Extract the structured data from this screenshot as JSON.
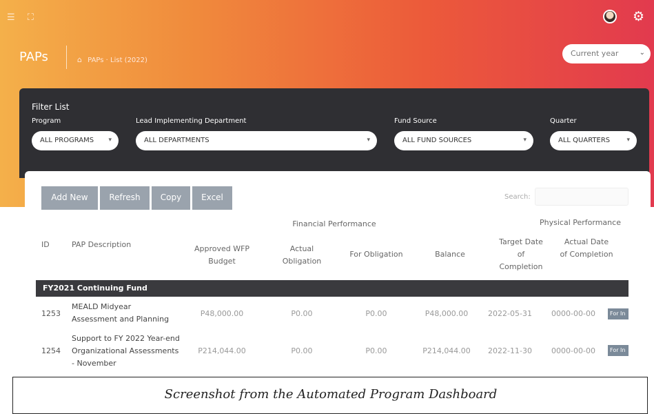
{
  "header": {
    "title": "PAPs",
    "breadcrumb": "PAPs · List (2022)",
    "year_select": "Current year"
  },
  "filter": {
    "title": "Filter List",
    "program": {
      "label": "Program",
      "value": "ALL PROGRAMS"
    },
    "department": {
      "label": "Lead Implementing Department",
      "value": "ALL DEPARTMENTS"
    },
    "fund_source": {
      "label": "Fund Source",
      "value": "ALL FUND SOURCES"
    },
    "quarter": {
      "label": "Quarter",
      "value": "ALL QUARTERS"
    }
  },
  "toolbar": {
    "add_new": "Add New",
    "refresh": "Refresh",
    "copy": "Copy",
    "excel": "Excel",
    "search_label": "Search:"
  },
  "table": {
    "group_financial": "Financial Performance",
    "group_physical": "Physical Performance",
    "col_id": "ID",
    "col_desc": "PAP Description",
    "col_budget": "Approved WFP Budget",
    "col_actual": "Actual Obligation",
    "col_for_obligation": "For Obligation",
    "col_balance": "Balance",
    "col_target": "Target Date of Completion",
    "col_actual_date": "Actual Date of Completion",
    "group_row": "FY2021 Continuing Fund",
    "rows": [
      {
        "id": "1253",
        "desc": "MEALD Midyear Assessment and Planning",
        "budget": "P48,000.00",
        "actual": "P0.00",
        "for_obligation": "P0.00",
        "balance": "P48,000.00",
        "target": "2022-05-31",
        "actual_date": "0000-00-00",
        "badge": "For In"
      },
      {
        "id": "1254",
        "desc": "Support to FY 2022 Year-end Organizational Assessments - November",
        "budget": "P214,044.00",
        "actual": "P0.00",
        "for_obligation": "P0.00",
        "balance": "P214,044.00",
        "target": "2022-11-30",
        "actual_date": "0000-00-00",
        "badge": "For In"
      }
    ]
  },
  "caption": "Screenshot from the Automated Program Dashboard"
}
